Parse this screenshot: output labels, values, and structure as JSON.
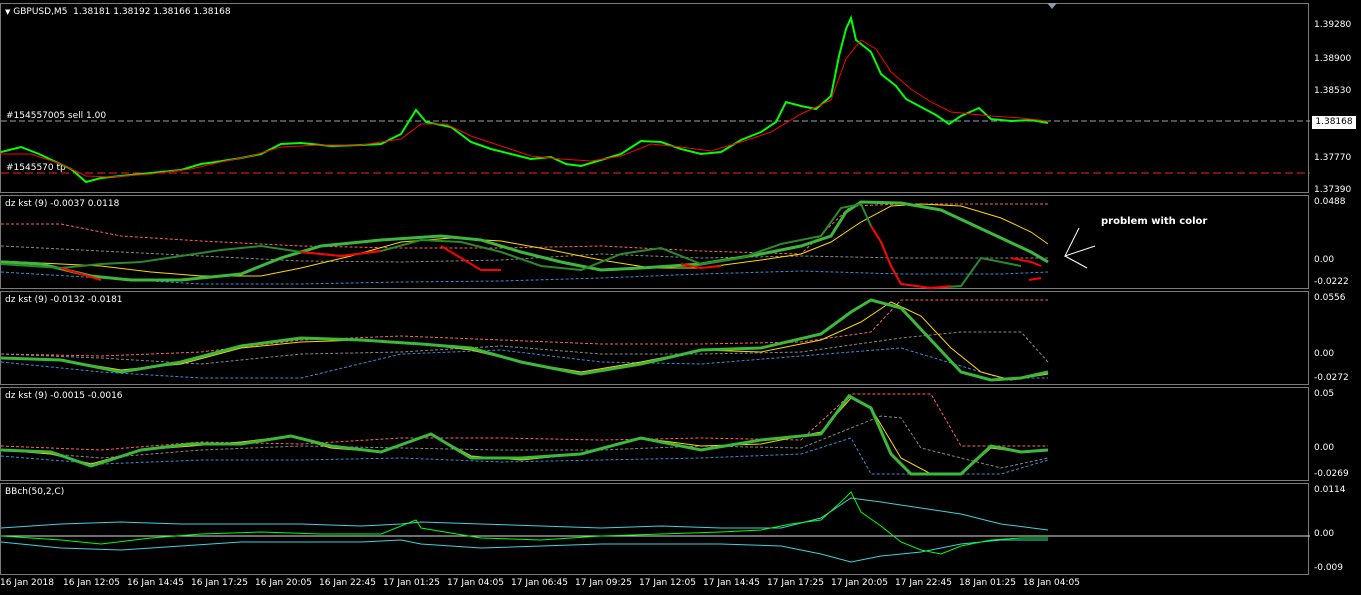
{
  "main": {
    "title": "GBPUSD,M5",
    "ohlc": "1.38181 1.38192 1.38166 1.38168",
    "order1": "#154557005 sell 1.00",
    "order2": "#1545570",
    "order2_tail": "tp",
    "price_label": "1.38168",
    "ticks": [
      "1.39280",
      "1.38900",
      "1.38530",
      "1.38168",
      "1.37770",
      "1.37390"
    ]
  },
  "kst1": {
    "label": "dz kst (9) -0.0037 0.0118",
    "annotation": "problem with color",
    "ticks": [
      "0.0488",
      "0.00",
      "-0.0222"
    ]
  },
  "kst2": {
    "label": "dz kst (9) -0.0132 -0.0181",
    "ticks": [
      "0.0556",
      "0.00",
      "-0.0272"
    ]
  },
  "kst3": {
    "label": "dz kst (9) -0.0015 -0.0016",
    "ticks": [
      "0.05",
      "0.00",
      "-0.0269"
    ]
  },
  "bb": {
    "label": "BBch(50,2,C)",
    "ticks": [
      "0.0114",
      "0.00",
      "-0.009"
    ]
  },
  "time_labels": [
    "16 Jan 2018",
    "16 Jan 12:05",
    "16 Jan 14:45",
    "16 Jan 17:25",
    "16 Jan 20:05",
    "16 Jan 22:45",
    "17 Jan 01:25",
    "17 Jan 04:05",
    "17 Jan 06:45",
    "17 Jan 09:25",
    "17 Jan 12:05",
    "17 Jan 14:45",
    "17 Jan 17:25",
    "17 Jan 20:05",
    "17 Jan 22:45",
    "18 Jan 01:25",
    "18 Jan 04:05"
  ],
  "colors": {
    "bull_candle": "#00ff00",
    "ma_red": "#ff0000",
    "kst_green": "#3cb83c",
    "kst_yellow": "#ffd700",
    "kst_dashed_red": "#ff6060",
    "kst_dashed_blue": "#3a8ad8",
    "bb_cyan": "#40d0e0"
  }
}
